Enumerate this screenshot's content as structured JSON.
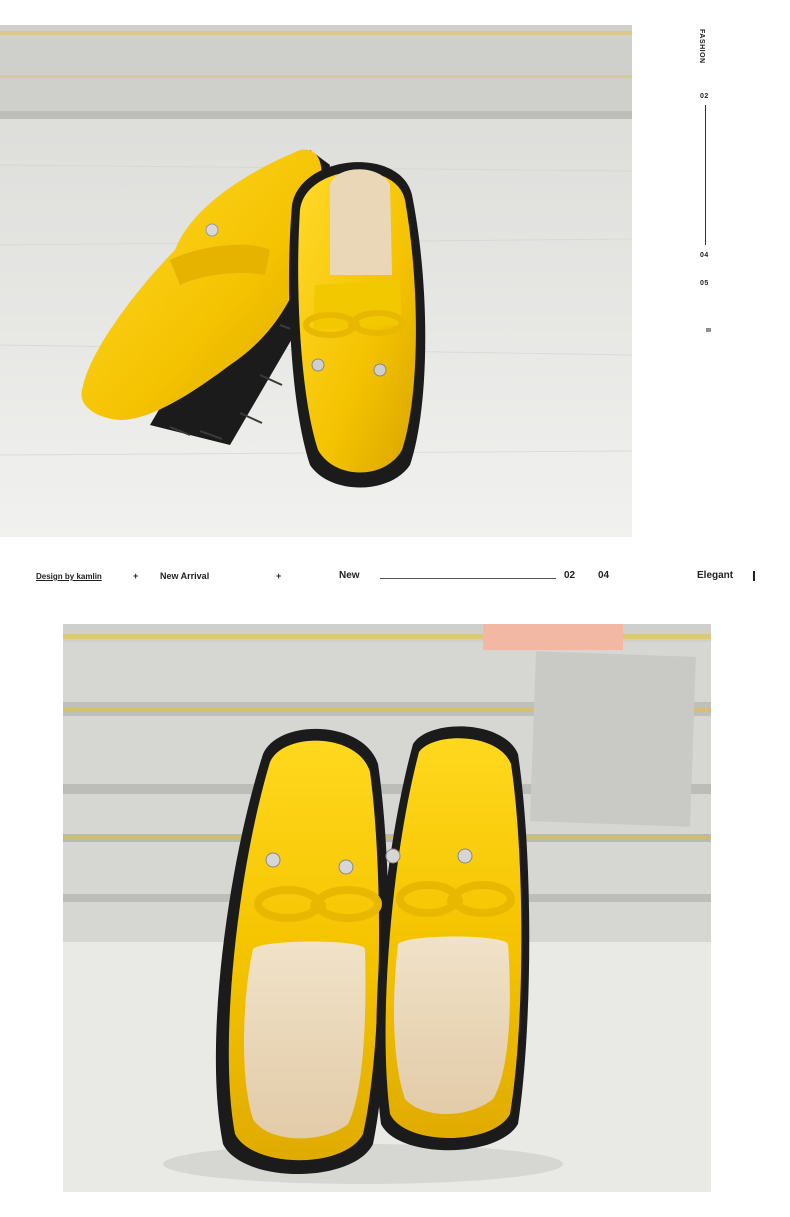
{
  "rail": {
    "label": "FASHION",
    "num_top": "02",
    "num_mid": "04",
    "num_bottom": "05",
    "mark": "II"
  },
  "bar": {
    "design": "Design by kamlin",
    "plus1": "+",
    "new_arrival": "New Arrival",
    "plus2": "+",
    "new": "New",
    "num1": "02",
    "num2": "04",
    "elegant": "Elegant"
  },
  "colors": {
    "shoe_yellow": "#f5c400",
    "sole_black": "#1b1b1b",
    "insole_beige": "#ead7b8",
    "wood_gray": "#e6e6e3"
  },
  "photos": [
    {
      "name": "product-photo-side-view",
      "icon": "yellow-loafers-photo"
    },
    {
      "name": "product-photo-top-view",
      "icon": "yellow-loafers-photo"
    }
  ]
}
